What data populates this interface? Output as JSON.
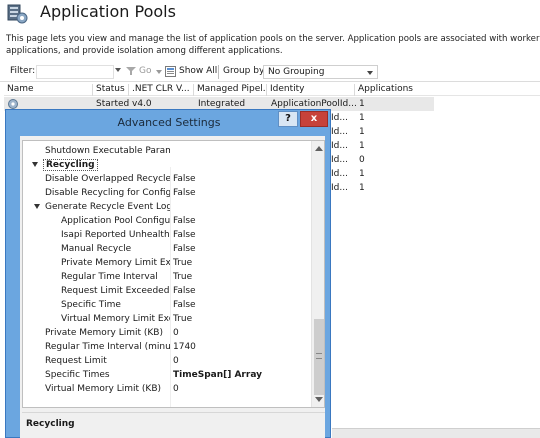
{
  "page": {
    "title": "Application Pools",
    "description_line1": "This page lets you view and manage the list of application pools on the server. Application pools are associated with worker processes, cont",
    "description_line2": "applications, and provide isolation among different applications."
  },
  "filter_bar": {
    "filter_label": "Filter:",
    "filter_value": "",
    "go_label": "Go",
    "show_all_label": "Show All",
    "group_by_label": "Group by:",
    "group_by_value": "No Grouping"
  },
  "grid": {
    "columns": [
      "Name",
      "Status",
      ".NET CLR V...",
      "Managed Pipel...",
      "Identity",
      "Applications"
    ],
    "rows": [
      {
        "name": "",
        "status": "Started",
        "clr": "v4.0",
        "pipeline": "Integrated",
        "identity": "ApplicationPoolId...",
        "applications": "1"
      },
      {
        "name": "",
        "status": "",
        "clr": "",
        "pipeline": "",
        "identity": "Id...",
        "applications": "1"
      },
      {
        "name": "",
        "status": "",
        "clr": "",
        "pipeline": "",
        "identity": "Id...",
        "applications": "1"
      },
      {
        "name": "",
        "status": "",
        "clr": "",
        "pipeline": "",
        "identity": "Id...",
        "applications": "1"
      },
      {
        "name": "",
        "status": "",
        "clr": "",
        "pipeline": "",
        "identity": "Id...",
        "applications": "0"
      },
      {
        "name": "",
        "status": "",
        "clr": "",
        "pipeline": "",
        "identity": "Id...",
        "applications": "1"
      },
      {
        "name": "",
        "status": "",
        "clr": "",
        "pipeline": "",
        "identity": "Id...",
        "applications": "1"
      }
    ]
  },
  "dialog": {
    "title": "Advanced Settings",
    "help_label": "?",
    "close_label": "x",
    "rows": [
      {
        "name": "Shutdown Executable Parameter",
        "value": ""
      },
      {
        "name": "Recycling",
        "value": ""
      },
      {
        "name": "Disable Overlapped Recycle",
        "value": "False"
      },
      {
        "name": "Disable Recycling for Configurat",
        "value": "False"
      },
      {
        "name": "Generate Recycle Event Log Entr",
        "value": ""
      },
      {
        "name": "Application Pool Configurat",
        "value": "False"
      },
      {
        "name": "Isapi Reported Unhealthy",
        "value": "False"
      },
      {
        "name": "Manual Recycle",
        "value": "False"
      },
      {
        "name": "Private Memory Limit Exceed",
        "value": "True"
      },
      {
        "name": "Regular Time Interval",
        "value": "True"
      },
      {
        "name": "Request Limit Exceeded",
        "value": "False"
      },
      {
        "name": "Specific Time",
        "value": "False"
      },
      {
        "name": "Virtual Memory Limit Exceed",
        "value": "True"
      },
      {
        "name": "Private Memory Limit (KB)",
        "value": "0"
      },
      {
        "name": "Regular Time Interval (minutes)",
        "value": "1740"
      },
      {
        "name": "Request Limit",
        "value": "0"
      },
      {
        "name": "Specific Times",
        "value": "TimeSpan[] Array"
      },
      {
        "name": "Virtual Memory Limit (KB)",
        "value": "0"
      }
    ],
    "description_title": "Recycling"
  },
  "colors": {
    "dialog_frame": "#6ba6e0",
    "close_button": "#c7423a",
    "selected_row": "#e8e8e8"
  }
}
